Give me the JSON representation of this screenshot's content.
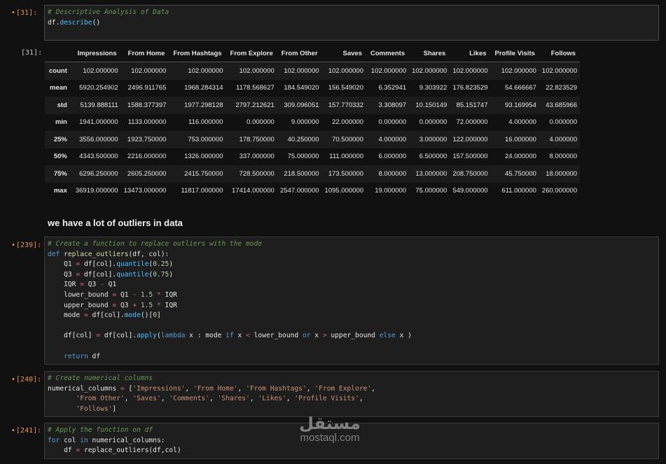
{
  "cells": {
    "c31": {
      "prompt": "[31]:",
      "comment": "# Descriptive Analysis of Data",
      "code_obj": "df",
      "code_method": "describe",
      "code_tail": "()"
    },
    "out31": {
      "prompt": "[31]:",
      "columns": [
        "",
        "Impressions",
        "From Home",
        "From Hashtags",
        "From Explore",
        "From Other",
        "Saves",
        "Comments",
        "Shares",
        "Likes",
        "Profile Visits",
        "Follows"
      ],
      "rows": [
        [
          "count",
          "102.000000",
          "102.000000",
          "102.000000",
          "102.000000",
          "102.000000",
          "102.000000",
          "102.000000",
          "102.000000",
          "102.000000",
          "102.000000",
          "102.000000"
        ],
        [
          "mean",
          "5920.254902",
          "2496.911765",
          "1968.284314",
          "1178.568627",
          "184.549020",
          "156.549020",
          "6.352941",
          "9.303922",
          "176.823529",
          "54.666667",
          "22.823529"
        ],
        [
          "std",
          "5139.888111",
          "1588.377397",
          "1977.298128",
          "2797.212621",
          "309.096051",
          "157.770332",
          "3.308097",
          "10.150149",
          "85.151747",
          "93.169954",
          "43.685966"
        ],
        [
          "min",
          "1941.000000",
          "1133.000000",
          "116.000000",
          "0.000000",
          "9.000000",
          "22.000000",
          "0.000000",
          "0.000000",
          "72.000000",
          "4.000000",
          "0.000000"
        ],
        [
          "25%",
          "3556.000000",
          "1923.750000",
          "753.000000",
          "178.750000",
          "40.250000",
          "70.500000",
          "4.000000",
          "3.000000",
          "122.000000",
          "16.000000",
          "4.000000"
        ],
        [
          "50%",
          "4343.500000",
          "2216.000000",
          "1326.000000",
          "337.000000",
          "75.000000",
          "111.000000",
          "6.000000",
          "6.500000",
          "157.500000",
          "24.000000",
          "8.000000"
        ],
        [
          "75%",
          "6296.250000",
          "2605.250000",
          "2415.750000",
          "728.500000",
          "218.500000",
          "173.500000",
          "8.000000",
          "13.000000",
          "208.750000",
          "45.750000",
          "18.000000"
        ],
        [
          "max",
          "36919.000000",
          "13473.000000",
          "11817.000000",
          "17414.000000",
          "2547.000000",
          "1095.000000",
          "19.000000",
          "75.000000",
          "549.000000",
          "611.000000",
          "260.000000"
        ]
      ]
    },
    "markdown": {
      "text": "we have a lot of outliers in data"
    },
    "c239": {
      "prompt": "[239]:",
      "comment": "# Create a function to replace outliers with the mode"
    },
    "c240": {
      "prompt": "[240]:",
      "comment": "# Create numerical columns"
    },
    "c241": {
      "prompt": "[241]:",
      "comment": "# Apply the function on df"
    }
  },
  "watermark": {
    "arabic": "مستقل",
    "latin": "mostaql.com"
  },
  "colors": {
    "background": "#111111",
    "cell_bg": "#1e1e1e",
    "prompt": "#e8945a",
    "comment": "#6a9955"
  }
}
